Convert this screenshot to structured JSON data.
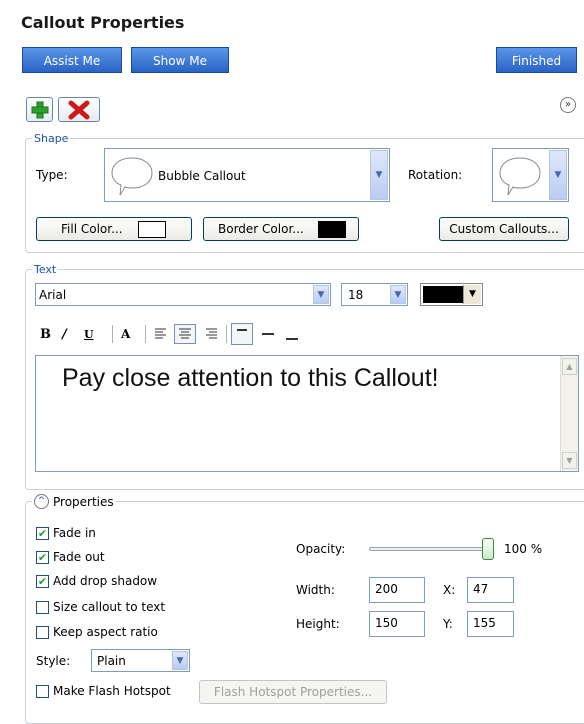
{
  "header": {
    "title": "Callout Properties",
    "assist_label": "Assist Me",
    "show_label": "Show Me",
    "finished_label": "Finished"
  },
  "shape": {
    "legend": "Shape",
    "type_label": "Type:",
    "type_value": "Bubble Callout",
    "rotation_label": "Rotation:",
    "fill_label": "Fill Color...",
    "fill_color": "#ffffff",
    "border_label": "Border Color...",
    "border_color": "#000000",
    "custom_label": "Custom Callouts..."
  },
  "text": {
    "legend": "Text",
    "font": "Arial",
    "size": "18",
    "color": "#000000",
    "content": "Pay close attention to this Callout!",
    "toolbar_icons": [
      "bold-icon",
      "italic-icon",
      "underline-icon",
      "font-style-icon",
      "align-left-icon",
      "align-center-icon",
      "align-right-icon",
      "valign-top-icon",
      "valign-middle-icon",
      "valign-bottom-icon"
    ]
  },
  "properties": {
    "legend": "Properties",
    "fade_in": {
      "label": "Fade in",
      "checked": true
    },
    "fade_out": {
      "label": "Fade out",
      "checked": true
    },
    "drop_shadow": {
      "label": "Add drop shadow",
      "checked": true
    },
    "size_to_text": {
      "label": "Size callout to text",
      "checked": false
    },
    "keep_aspect": {
      "label": "Keep aspect ratio",
      "checked": false
    },
    "style_label": "Style:",
    "style_value": "Plain",
    "flash_hotspot": {
      "label": "Make Flash Hotspot",
      "checked": false
    },
    "flash_props_label": "Flash Hotspot Properties...",
    "opacity_label": "Opacity:",
    "opacity_value": "100 %",
    "opacity_fraction": 1.0,
    "width_label": "Width:",
    "width_value": "200",
    "height_label": "Height:",
    "height_value": "150",
    "x_label": "X:",
    "x_value": "47",
    "y_label": "Y:",
    "y_value": "155"
  }
}
